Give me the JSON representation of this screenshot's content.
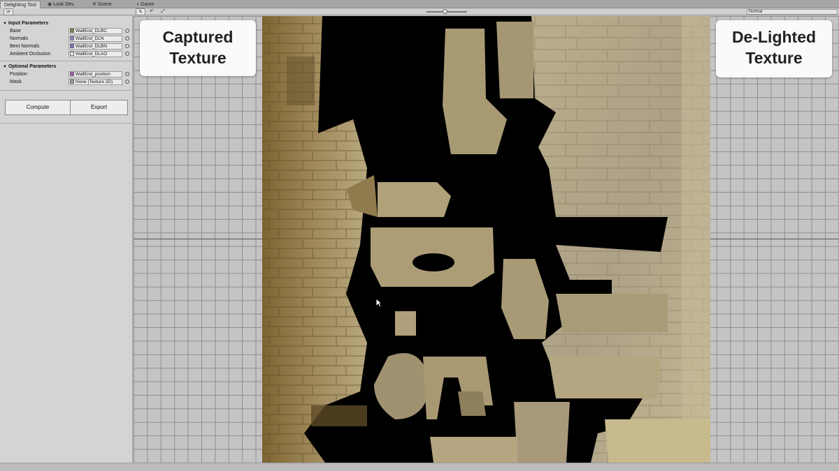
{
  "tabs": [
    {
      "label": "Delighting Tool",
      "icon": ""
    },
    {
      "label": "Look Dev",
      "icon": "lookdev-icon"
    },
    {
      "label": "Scene",
      "icon": "scene-icon"
    },
    {
      "label": "Game",
      "icon": "game-icon"
    }
  ],
  "toolbar": {
    "render_mode": "Normal"
  },
  "panel": {
    "input_section": "Input Parameters",
    "inputs": [
      {
        "label": "Base",
        "value": "WallEnd_DLBC",
        "swatch": "#8a7a55"
      },
      {
        "label": "Normals",
        "value": "WallEnd_DLN",
        "swatch": "#8f86d8"
      },
      {
        "label": "Bent Normals",
        "value": "WallEnd_DLBN",
        "swatch": "#7f70d0"
      },
      {
        "label": "Ambient Occlusion",
        "value": "WallEnd_DLAO",
        "swatch": "#f0f0f0"
      }
    ],
    "optional_section": "Optional Parameters",
    "optional": [
      {
        "label": "Position",
        "value": "WallEnd_position",
        "swatch": "#b05aa8"
      },
      {
        "label": "Mask",
        "value": "None (Texture 2D)",
        "swatch": "#9aa0a8"
      }
    ],
    "compute_label": "Compute",
    "export_label": "Export"
  },
  "viewport": {
    "left_callout_line1": "Captured",
    "left_callout_line2": "Texture",
    "right_callout_line1": "De-Lighted",
    "right_callout_line2": "Texture"
  },
  "colors": {
    "grid_bg": "#c4c4c4",
    "grid_line": "#8e8e8e",
    "texture_warm": "#8a7340",
    "texture_light": "#b9ab86"
  }
}
